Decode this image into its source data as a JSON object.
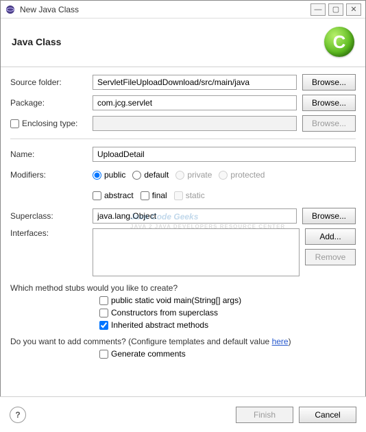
{
  "window": {
    "title": "New Java Class",
    "icon": "eclipse-icon",
    "controls": {
      "min": "—",
      "max": "▢",
      "close": "✕"
    }
  },
  "header": {
    "title": "Java Class",
    "badge_letter": "C"
  },
  "fields": {
    "source_folder": {
      "label": "Source folder:",
      "value": "ServletFileUploadDownload/src/main/java",
      "browse": "Browse..."
    },
    "package": {
      "label": "Package:",
      "value": "com.jcg.servlet",
      "browse": "Browse..."
    },
    "enclosing_type": {
      "label": "Enclosing type:",
      "checked": false,
      "value": "",
      "browse": "Browse..."
    },
    "name": {
      "label": "Name:",
      "value": "UploadDetail"
    },
    "modifiers": {
      "label": "Modifiers:",
      "access": {
        "public": "public",
        "default": "default",
        "private": "private",
        "protected": "protected",
        "selected": "public"
      },
      "flags": {
        "abstract": "abstract",
        "final": "final",
        "static_": "static"
      }
    },
    "superclass": {
      "label": "Superclass:",
      "value": "java.lang.Object",
      "browse": "Browse..."
    },
    "interfaces": {
      "label": "Interfaces:",
      "add": "Add...",
      "remove": "Remove"
    }
  },
  "stubs": {
    "question": "Which method stubs would you like to create?",
    "main": "public static void main(String[] args)",
    "constructors": "Constructors from superclass",
    "inherited": "Inherited abstract methods",
    "inherited_checked": true
  },
  "comments": {
    "question_prefix": "Do you want to add comments? (Configure templates and default value ",
    "link": "here",
    "question_suffix": ")",
    "generate": "Generate comments"
  },
  "footer": {
    "help": "?",
    "finish": "Finish",
    "cancel": "Cancel"
  },
  "watermark": {
    "line1": "Java Code Geeks",
    "line2": "JAVA 2 JAVA DEVELOPERS RESOURCE CENTER"
  }
}
